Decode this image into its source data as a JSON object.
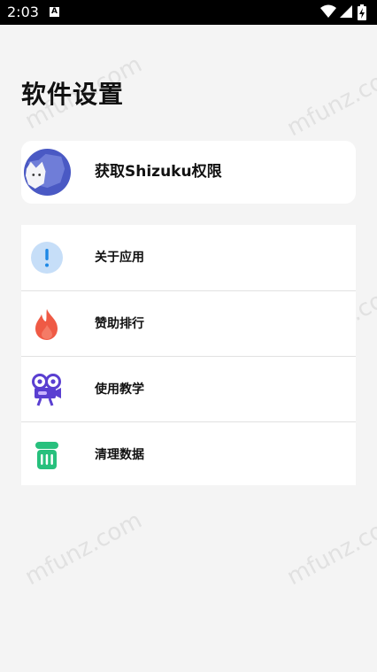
{
  "status_bar": {
    "time": "2:03",
    "notification_icon": "a-icon",
    "icons": [
      "wifi-icon",
      "signal-icon",
      "battery-charging-icon"
    ]
  },
  "page": {
    "title": "软件设置"
  },
  "shizuku": {
    "label": "获取Shizuku权限",
    "icon": "shizuku-avatar-icon"
  },
  "menu": {
    "items": [
      {
        "label": "关于应用",
        "icon": "info-icon",
        "color": "#1e88e5"
      },
      {
        "label": "赞助排行",
        "icon": "flame-icon",
        "color": "#ef5a45"
      },
      {
        "label": "使用教学",
        "icon": "video-camera-icon",
        "color": "#5a3fd1"
      },
      {
        "label": "清理数据",
        "icon": "trash-icon",
        "color": "#27c07d"
      }
    ]
  },
  "watermark": {
    "text": "mfunz.com"
  }
}
